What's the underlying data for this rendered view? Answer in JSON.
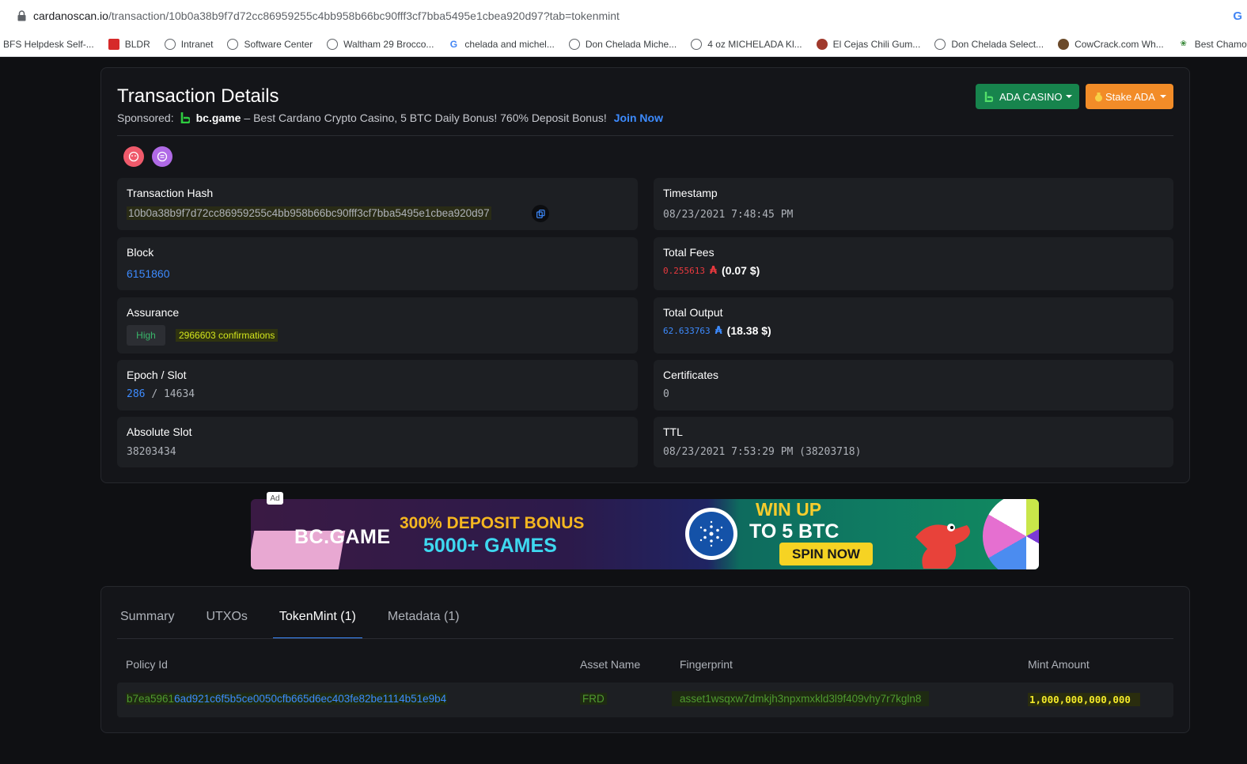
{
  "browser": {
    "url_host": "cardanoscan.io",
    "url_path": "/transaction/10b0a38b9f7d72cc86959255c4bb958b66bc90fff3cf7bba5495e1cbea920d97?tab=tokenmint",
    "bookmarks": [
      "BFS Helpdesk Self-...",
      "BLDR",
      "Intranet",
      "Software Center",
      "Waltham 29 Brocco...",
      "chelada and michel...",
      "Don Chelada Miche...",
      "4 oz MICHELADA Kl...",
      "El Cejas Chili Gum...",
      "Don Chelada Select...",
      "CowCrack.com Wh...",
      "Best Chamoy Sau"
    ]
  },
  "header": {
    "title": "Transaction Details",
    "sponsored_label": "Sponsored:",
    "sponsor_brand": "bc.game",
    "sponsor_text": "– Best Cardano Crypto Casino, 5 BTC Daily Bonus! 760% Deposit Bonus!",
    "sponsor_link": "Join Now",
    "casino_button": "ADA CASINO",
    "stake_button": "Stake ADA"
  },
  "details": {
    "tx_hash_label": "Transaction Hash",
    "tx_hash": "10b0a38b9f7d72cc86959255c4bb958b66bc90fff3cf7bba5495e1cbea920d97",
    "timestamp_label": "Timestamp",
    "timestamp": "08/23/2021 7:48:45 PM",
    "block_label": "Block",
    "block": "6151860",
    "total_fees_label": "Total Fees",
    "total_fees": "0.255613",
    "total_fees_usd": "(0.07 $)",
    "assurance_label": "Assurance",
    "assurance_level": "High",
    "confirmations": "2966603 confirmations",
    "total_output_label": "Total Output",
    "total_output": "62.633763",
    "total_output_usd": "(18.38 $)",
    "epoch_slot_label": "Epoch / Slot",
    "epoch": "286",
    "slot_sep": "/",
    "slot": "14634",
    "certificates_label": "Certificates",
    "certificates": "0",
    "absolute_slot_label": "Absolute Slot",
    "absolute_slot": "38203434",
    "ttl_label": "TTL",
    "ttl": "08/23/2021 7:53:29 PM (38203718)",
    "ada_symbol": "₳"
  },
  "ad": {
    "tag": "Ad",
    "brand": "BC.GAME",
    "line1": "300% DEPOSIT BONUS",
    "line2": "5000+ GAMES",
    "win1": "WIN UP",
    "win2": "TO 5 BTC",
    "cta": "SPIN NOW"
  },
  "tabs": [
    {
      "label": "Summary",
      "active": false
    },
    {
      "label": "UTXOs",
      "active": false
    },
    {
      "label": "TokenMint (1)",
      "active": true
    },
    {
      "label": "Metadata (1)",
      "active": false
    }
  ],
  "table": {
    "headers": [
      "Policy Id",
      "Asset Name",
      "Fingerprint",
      "Mint Amount"
    ],
    "rows": [
      {
        "policy_id_a": "b7ea5961",
        "policy_id_b": "6ad921c6f5b5ce0050cfb665d6ec403fe82be1114b51e9b4",
        "asset_name": "FRD",
        "fingerprint": "asset1wsqxw7dmkjh3npxmxkld3l9f409vhy7r7kgln8",
        "mint_amount": "1,000,000,000,000"
      }
    ]
  },
  "colors": {
    "accent_blue": "#3d8bff",
    "casino_green": "#17844d",
    "stake_orange": "#f28c28",
    "fee_red": "#e9393e"
  }
}
